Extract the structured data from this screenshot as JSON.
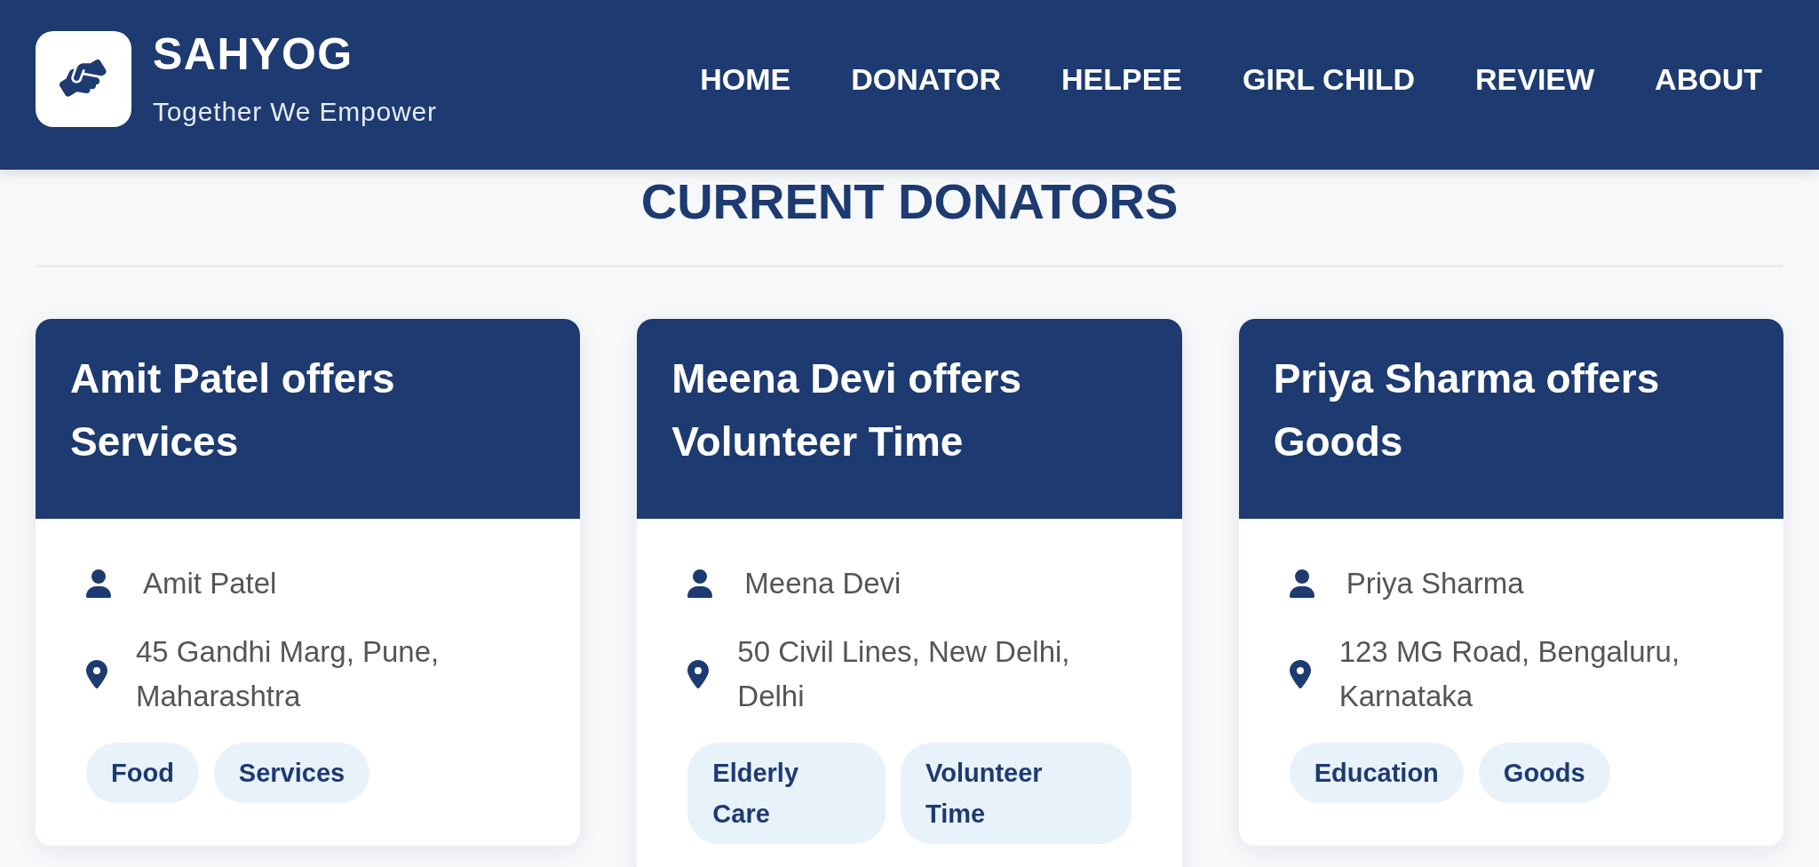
{
  "header": {
    "brand": {
      "name": "SAHYOG",
      "tagline": "Together We Empower"
    },
    "nav": [
      "HOME",
      "DONATOR",
      "HELPEE",
      "GIRL CHILD",
      "REVIEW",
      "ABOUT"
    ]
  },
  "section": {
    "title": "CURRENT DONATORS"
  },
  "cards": [
    {
      "title": "Amit Patel offers Services",
      "name": "Amit Patel",
      "address": "45 Gandhi Marg, Pune, Maharashtra",
      "tags": [
        "Food",
        "Services"
      ]
    },
    {
      "title": "Meena Devi offers Volunteer Time",
      "name": "Meena Devi",
      "address": "50 Civil Lines, New Delhi, Delhi",
      "tags": [
        "Elderly Care",
        "Volunteer Time"
      ]
    },
    {
      "title": "Priya Sharma offers Goods",
      "name": "Priya Sharma",
      "address": "123 MG Road, Bengaluru, Karnataka",
      "tags": [
        "Education",
        "Goods"
      ]
    }
  ]
}
